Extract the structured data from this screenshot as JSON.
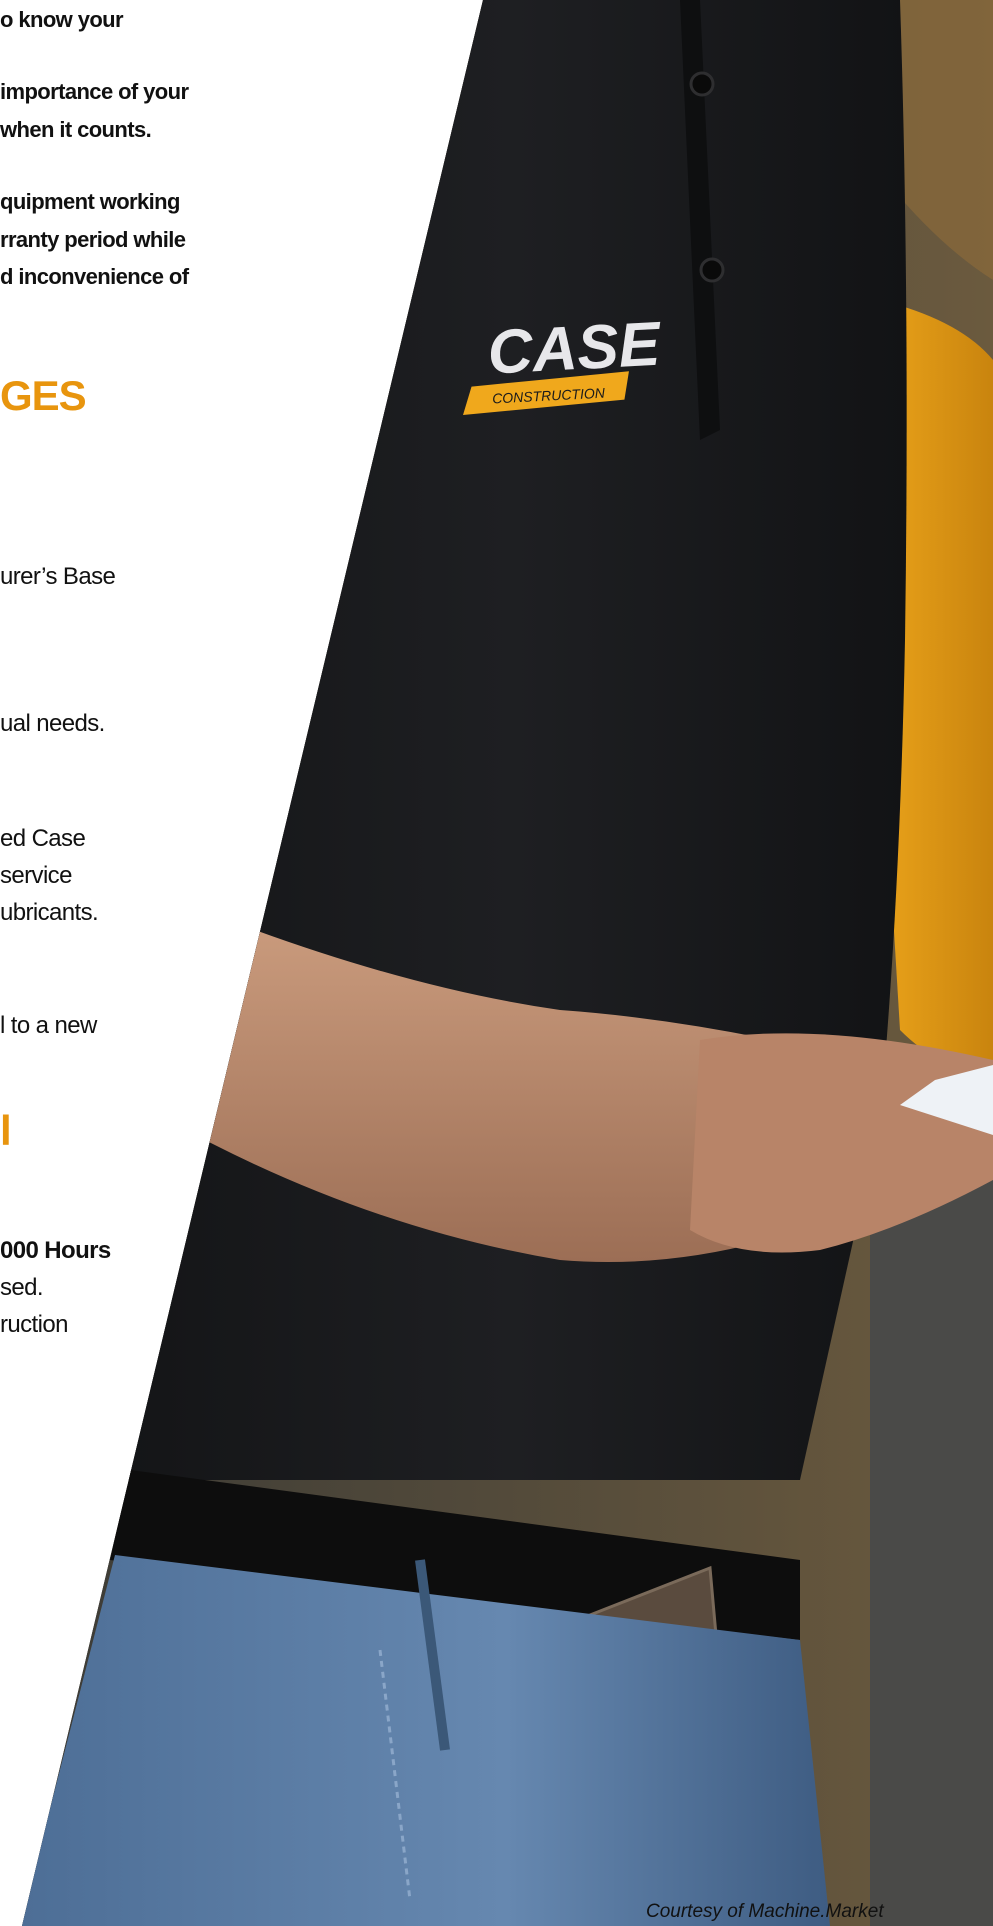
{
  "intro": {
    "lines": [
      "o know your",
      "importance of your",
      "when it counts.",
      "quipment working",
      "rranty period while",
      "d inconvenience of"
    ]
  },
  "headings": {
    "advantages": "GES",
    "coverage": "l"
  },
  "body": {
    "lines": [
      "urer’s Base",
      "ual needs.",
      "ed Case",
      "service",
      "ubricants.",
      "l to a new",
      "000 Hours",
      "sed.",
      "ruction"
    ]
  },
  "photo": {
    "logo_text": "CASE",
    "logo_subtext": "CONSTRUCTION",
    "brand_yellow": "#f0a81c",
    "shirt_color": "#1b1c1e",
    "jeans_color": "#5c7ea6"
  },
  "credit": "Courtesy of Machine.Market"
}
